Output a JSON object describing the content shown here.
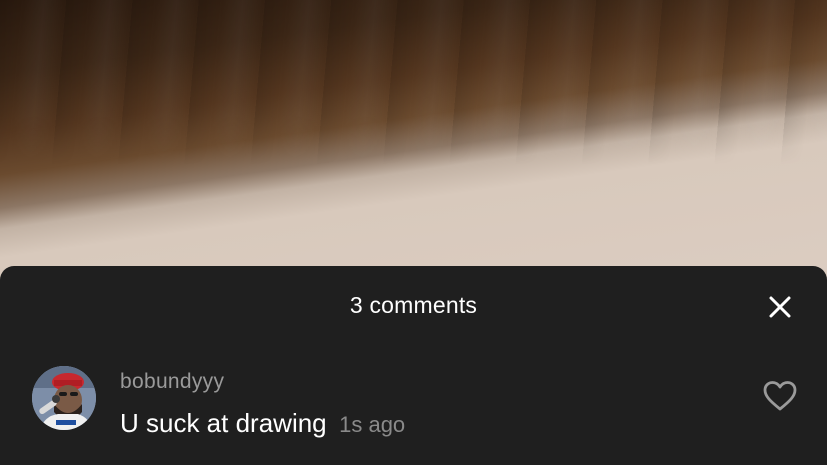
{
  "comments_sheet": {
    "title": "3 comments",
    "close_icon": "close-icon"
  },
  "comments": [
    {
      "username": "bobundyyy",
      "text": "U suck at drawing",
      "time": "1s ago",
      "avatar_icon": "avatar",
      "like_icon": "heart-outline-icon"
    }
  ],
  "colors": {
    "sheet_background": "#1f1f1f",
    "title_text": "#ffffff",
    "username_text": "#9a9a9a",
    "timestamp_text": "#8a8a8a"
  }
}
